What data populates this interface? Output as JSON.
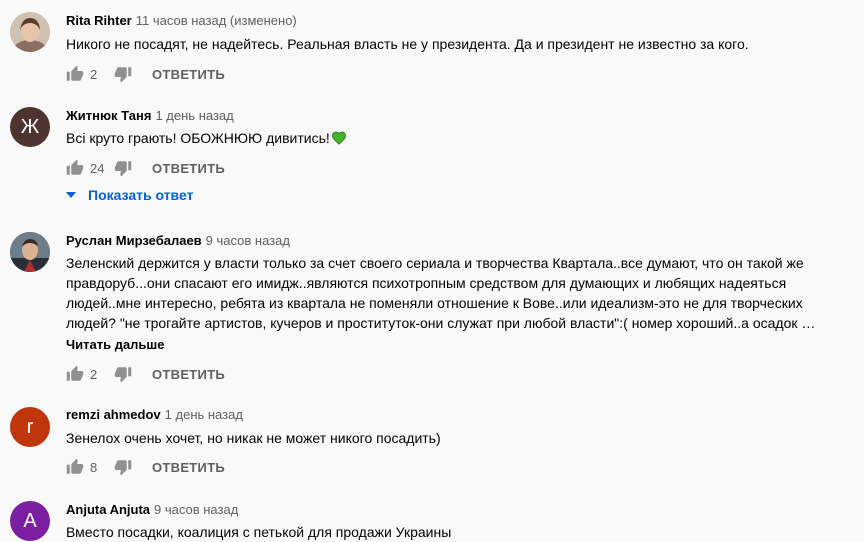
{
  "comments": [
    {
      "author": "Rita Rihter",
      "time": "11 часов назад (изменено)",
      "text": "Никого не посадят, не надейтесь. Реальная власть не у президента. Да и президент не известно за кого.",
      "likes": "2",
      "reply_label": "ОТВЕТИТЬ"
    },
    {
      "author": "Житнюк Таня",
      "time": "1 день назад",
      "avatar_letter": "Ж",
      "avatar_color": "#4e342e",
      "text": "Всі круто грають! ОБОЖНЮЮ дивитись!",
      "likes": "24",
      "reply_label": "ОТВЕТИТЬ",
      "show_replies": "Показать ответ"
    },
    {
      "author": "Руслан Мирзебалаев",
      "time": "9 часов назад",
      "text_lines": [
        "Зеленский держится у власти только за счет своего сериала и творчества Квартала..все думают, что он такой же",
        "правдоруб...они спасают его имидж..являются психотропным средством для думающих и любящих надеяться",
        "людей..мне интересно, ребята из квартала не поменяли отношение к Вове..или идеализм-это не для творческих",
        "людей? \"не трогайте артистов, кучеров и проституток-они служат при любой власти\":( номер хороший..а осадок …"
      ],
      "read_more": "Читать дальше",
      "likes": "2",
      "reply_label": "ОТВЕТИТЬ"
    },
    {
      "author": "remzi ahmedov",
      "time": "1 день назад",
      "avatar_letter": "r",
      "avatar_color": "#bf360c",
      "text": "Зенелох очень хочет, но никак не может никого посадить)",
      "likes": "8",
      "reply_label": "ОТВЕТИТЬ"
    },
    {
      "author": "Anjuta Anjuta",
      "time": "9 часов назад",
      "avatar_letter": "A",
      "avatar_color": "#7b1fa2",
      "text": "Вместо посадки, коалиция с петькой для продажи Украины"
    }
  ]
}
